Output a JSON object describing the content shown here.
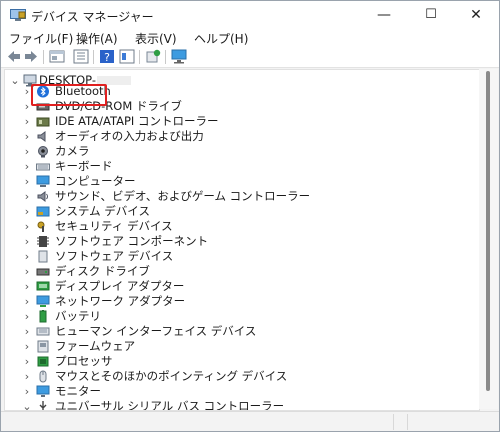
{
  "window": {
    "title": "デバイス マネージャー",
    "minimize_glyph": "—",
    "maximize_glyph": "☐",
    "close_glyph": "✕"
  },
  "menu": [
    "ファイル(F)",
    "操作(A)",
    "表示(V)",
    "ヘルプ(H)"
  ],
  "toolbar": {
    "icons": [
      "back-arrow-icon",
      "forward-arrow-icon",
      "properties-panel-icon",
      "console-tree-icon",
      "help-icon",
      "view-pane-icon",
      "update-driver-icon",
      "scan-hardware-monitor-icon"
    ]
  },
  "tree": {
    "root": "DESKTOP-",
    "highlighted": "Bluetooth",
    "items": [
      {
        "label": "Bluetooth",
        "icon": "bluetooth-icon",
        "expanded": false
      },
      {
        "label": "DVD/CD-ROM ドライブ",
        "icon": "dvd-drive-icon",
        "expanded": false
      },
      {
        "label": "IDE ATA/ATAPI コントローラー",
        "icon": "ide-controller-icon",
        "expanded": false
      },
      {
        "label": "オーディオの入力および出力",
        "icon": "speaker-icon",
        "expanded": false
      },
      {
        "label": "カメラ",
        "icon": "camera-icon",
        "expanded": false
      },
      {
        "label": "キーボード",
        "icon": "keyboard-icon",
        "expanded": false
      },
      {
        "label": "コンピューター",
        "icon": "computer-icon",
        "expanded": false
      },
      {
        "label": "サウンド、ビデオ、およびゲーム コントローラー",
        "icon": "sound-icon",
        "expanded": false
      },
      {
        "label": "システム デバイス",
        "icon": "system-device-icon",
        "expanded": false
      },
      {
        "label": "セキュリティ デバイス",
        "icon": "security-key-icon",
        "expanded": false
      },
      {
        "label": "ソフトウェア コンポーネント",
        "icon": "software-component-icon",
        "expanded": false
      },
      {
        "label": "ソフトウェア デバイス",
        "icon": "software-device-icon",
        "expanded": false
      },
      {
        "label": "ディスク ドライブ",
        "icon": "disk-drive-icon",
        "expanded": false
      },
      {
        "label": "ディスプレイ アダプター",
        "icon": "display-adapter-icon",
        "expanded": false
      },
      {
        "label": "ネットワーク アダプター",
        "icon": "network-adapter-icon",
        "expanded": false
      },
      {
        "label": "バッテリ",
        "icon": "battery-icon",
        "expanded": false
      },
      {
        "label": "ヒューマン インターフェイス デバイス",
        "icon": "hid-icon",
        "expanded": false
      },
      {
        "label": "ファームウェア",
        "icon": "firmware-icon",
        "expanded": false
      },
      {
        "label": "プロセッサ",
        "icon": "processor-icon",
        "expanded": false
      },
      {
        "label": "マウスとそのほかのポインティング デバイス",
        "icon": "mouse-icon",
        "expanded": false
      },
      {
        "label": "モニター",
        "icon": "monitor-icon",
        "expanded": false
      },
      {
        "label": "ユニバーサル シリアル バス コントローラー",
        "icon": "usb-icon",
        "expanded": true
      }
    ]
  },
  "colors": {
    "highlight_border": "#e02020",
    "bluetooth_blue": "#1e6fd9"
  }
}
